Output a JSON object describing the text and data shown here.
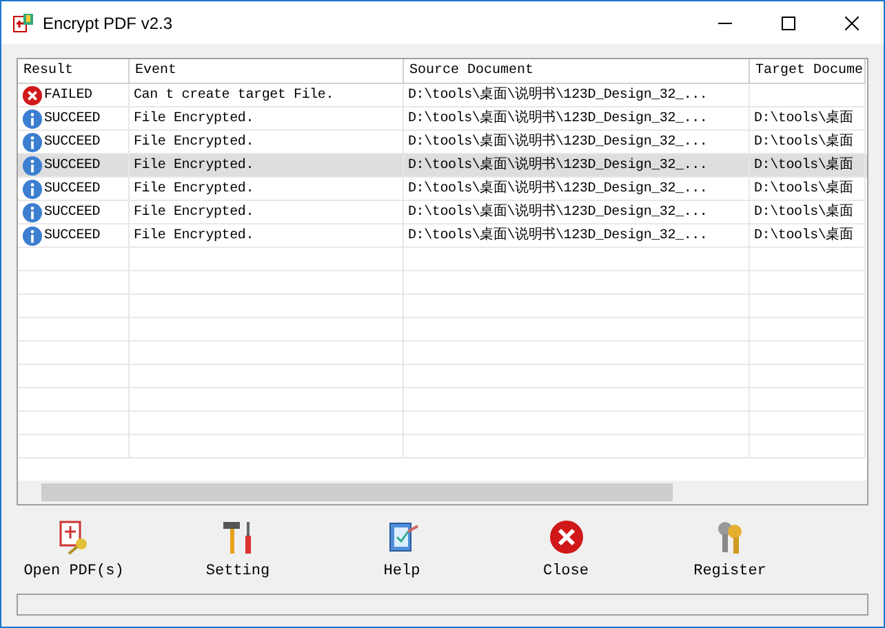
{
  "window": {
    "title": "Encrypt PDF v2.3"
  },
  "table": {
    "columns": [
      "Result",
      "Event",
      "Source Document",
      "Target Docume"
    ],
    "rows": [
      {
        "kind": "error",
        "result": "FAILED",
        "event": "Can t create target File.",
        "source": "D:\\tools\\桌面\\说明书\\123D_Design_32_...",
        "target": "",
        "selected": false
      },
      {
        "kind": "info",
        "result": "SUCCEED",
        "event": "File Encrypted.",
        "source": "D:\\tools\\桌面\\说明书\\123D_Design_32_...",
        "target": "D:\\tools\\桌面",
        "selected": false
      },
      {
        "kind": "info",
        "result": "SUCCEED",
        "event": "File Encrypted.",
        "source": "D:\\tools\\桌面\\说明书\\123D_Design_32_...",
        "target": "D:\\tools\\桌面",
        "selected": false
      },
      {
        "kind": "info",
        "result": "SUCCEED",
        "event": "File Encrypted.",
        "source": "D:\\tools\\桌面\\说明书\\123D_Design_32_...",
        "target": "D:\\tools\\桌面",
        "selected": true
      },
      {
        "kind": "info",
        "result": "SUCCEED",
        "event": "File Encrypted.",
        "source": "D:\\tools\\桌面\\说明书\\123D_Design_32_...",
        "target": "D:\\tools\\桌面",
        "selected": false
      },
      {
        "kind": "info",
        "result": "SUCCEED",
        "event": "File Encrypted.",
        "source": "D:\\tools\\桌面\\说明书\\123D_Design_32_...",
        "target": "D:\\tools\\桌面",
        "selected": false
      },
      {
        "kind": "info",
        "result": "SUCCEED",
        "event": "File Encrypted.",
        "source": "D:\\tools\\桌面\\说明书\\123D_Design_32_...",
        "target": "D:\\tools\\桌面",
        "selected": false
      }
    ]
  },
  "toolbar": [
    {
      "kind": "open",
      "label": "Open PDF(s)"
    },
    {
      "kind": "setting",
      "label": "Setting"
    },
    {
      "kind": "help",
      "label": "Help"
    },
    {
      "kind": "close",
      "label": "Close"
    },
    {
      "kind": "register",
      "label": "Register"
    }
  ]
}
